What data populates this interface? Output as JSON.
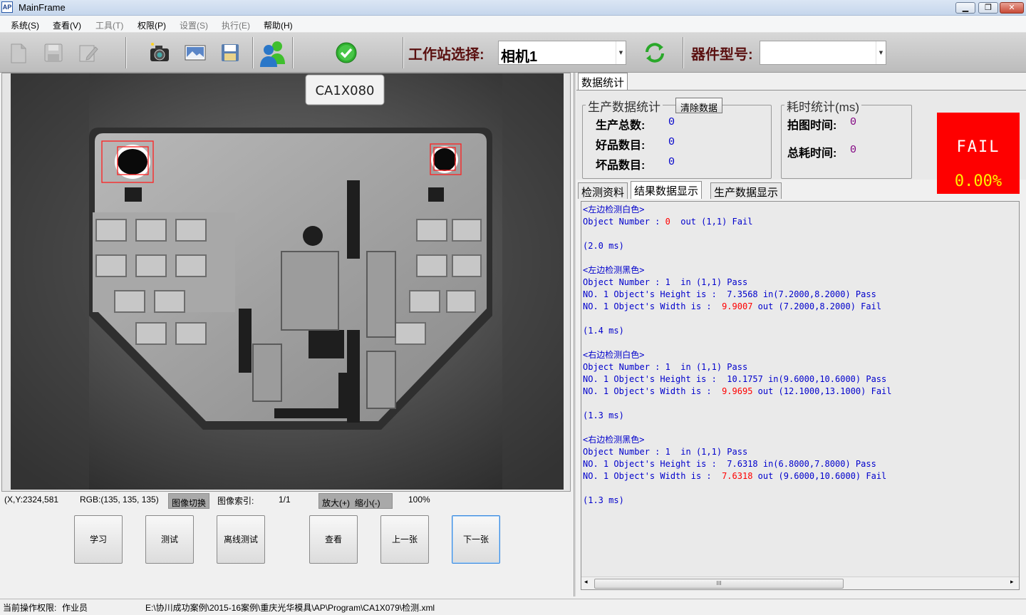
{
  "window": {
    "title": "MainFrame",
    "app_icon": "AP"
  },
  "menu": [
    {
      "label": "系统(S)",
      "enabled": true
    },
    {
      "label": "查看(V)",
      "enabled": true
    },
    {
      "label": "工具(T)",
      "enabled": false
    },
    {
      "label": "权限(P)",
      "enabled": true
    },
    {
      "label": "设置(S)",
      "enabled": false
    },
    {
      "label": "执行(E)",
      "enabled": false
    },
    {
      "label": "帮助(H)",
      "enabled": true
    }
  ],
  "toolbar": {
    "icons": [
      "new-doc-icon",
      "save-icon",
      "edit-icon",
      "camera-icon",
      "image-icon",
      "save-image-icon",
      "users-icon",
      "check-icon"
    ],
    "station_label": "工作站选择:",
    "station_value": "相机1",
    "part_label": "器件型号:",
    "part_value": ""
  },
  "image": {
    "label_text": "CA1X080"
  },
  "viewer_status": {
    "coord": "(X,Y:2324,581",
    "rgb": "RGB:(135, 135, 135)",
    "switch_btn": "图像切换",
    "index_label": "图像索引:",
    "index_value": "1/1",
    "zoom_in": "放大(+)",
    "zoom_out": "缩小(-)",
    "zoom_value": "100%"
  },
  "buttons": [
    "学习",
    "测试",
    "离线测试",
    "查看",
    "上一张",
    "下一张"
  ],
  "right": {
    "top_tab": "数据统计",
    "prod_group": "生产数据统计",
    "clear_btn": "清除数据",
    "total_label": "生产总数:",
    "total_value": "0",
    "good_label": "好品数目:",
    "good_value": "0",
    "bad_label": "坏品数目:",
    "bad_value": "0",
    "time_group": "耗时统计(ms)",
    "capture_label": "拍图时间:",
    "capture_value": "0",
    "total_time_label": "总耗时间:",
    "total_time_value": "0",
    "result": "FAIL",
    "rate": "0.00%",
    "tabs": [
      "检测资料",
      "结果数据显示",
      "生产数据显示"
    ],
    "active_tab": 1
  },
  "log": [
    {
      "t": "<左边检测白色>"
    },
    {
      "t": "Object Number : ",
      "r": "0",
      "t2": "  out (1,1) Fail"
    },
    {
      "t": ""
    },
    {
      "t": "(2.0 ms)"
    },
    {
      "t": ""
    },
    {
      "t": "<左边检测黑色>"
    },
    {
      "t": "Object Number : 1  in (1,1) Pass"
    },
    {
      "t": "NO. 1 Object's Height is :  7.3568 in(7.2000,8.2000) Pass"
    },
    {
      "t": "NO. 1 Object's Width is :  ",
      "r": "9.9007",
      "t2": " out (7.2000,8.2000) Fail"
    },
    {
      "t": ""
    },
    {
      "t": "(1.4 ms)"
    },
    {
      "t": ""
    },
    {
      "t": "<右边检测白色>"
    },
    {
      "t": "Object Number : 1  in (1,1) Pass"
    },
    {
      "t": "NO. 1 Object's Height is :  10.1757 in(9.6000,10.6000) Pass"
    },
    {
      "t": "NO. 1 Object's Width is :  ",
      "r": "9.9695",
      "t2": " out (12.1000,13.1000) Fail"
    },
    {
      "t": ""
    },
    {
      "t": "(1.3 ms)"
    },
    {
      "t": ""
    },
    {
      "t": "<右边检测黑色>"
    },
    {
      "t": "Object Number : 1  in (1,1) Pass"
    },
    {
      "t": "NO. 1 Object's Height is :  7.6318 in(6.8000,7.8000) Pass"
    },
    {
      "t": "NO. 1 Object's Width is :  ",
      "r": "7.6318",
      "t2": " out (9.6000,10.6000) Fail"
    },
    {
      "t": ""
    },
    {
      "t": "(1.3 ms)"
    }
  ],
  "scrollbar": {
    "thumb_glyph": "III"
  },
  "statusbar": {
    "perm_label": "当前操作权限:",
    "perm_value": "作业员",
    "path": "E:\\协川成功案例\\2015-16案例\\重庆光华模具\\AP\\Program\\CA1X079\\检测.xml"
  },
  "colors": {
    "fail_bg": "#fe0000",
    "fail_text": "#ffffff",
    "rate_text": "#fff200",
    "log_text": "#0000cc",
    "log_fail": "#ff0000"
  }
}
